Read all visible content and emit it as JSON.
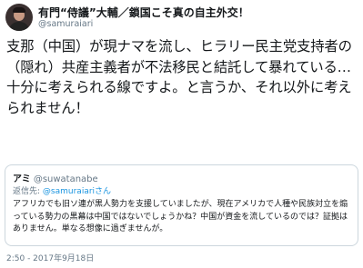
{
  "tweet": {
    "display_name": "有門“侍議”大輔／鎖国こそ真の自主外交！",
    "handle": "@samuraiari",
    "text": "支那（中国）が現ナマを流し、ヒラリー民主党支持者の（隠れ）共産主義者が不法移民と結託して暴れている…十分に考えられる線ですよ。と言うか、それ以外に考えられません！",
    "timestamp": "2:50 - 2017年9月18日"
  },
  "quoted_tweet": {
    "display_name": "アミ",
    "handle": "@suwatanabe",
    "reply_prefix": "返信先:",
    "reply_target": "@samuraiariさん",
    "text": "アフリカでも旧ソ連が黒人勢力を支援していましたが、現在アメリカで人種や民族対立を煽っている勢力の黒幕は中国ではないでしょうかね？中国が資金を流しているのでは？証拠はありません。単なる想像に過ぎませんが。"
  }
}
